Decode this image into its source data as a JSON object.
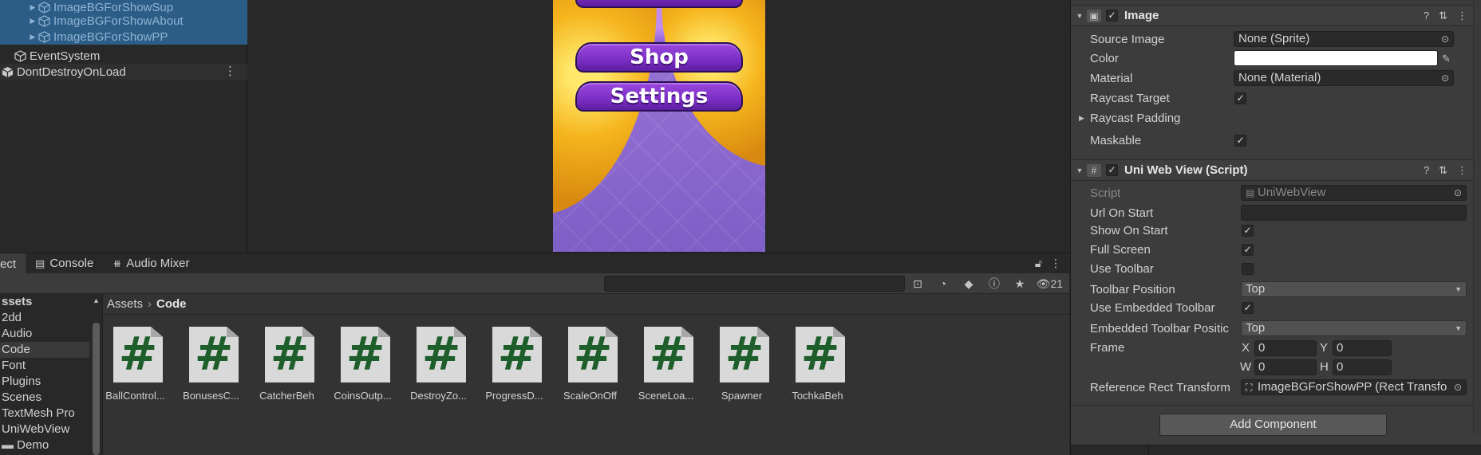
{
  "hierarchy": {
    "items": [
      {
        "label": "ImageBGForShowSup"
      },
      {
        "label": "ImageBGForShowAbout"
      },
      {
        "label": "ImageBGForShowPP"
      },
      {
        "label": "EventSystem"
      },
      {
        "label": "DontDestroyOnLoad"
      }
    ],
    "more_glyph": "⋮"
  },
  "game": {
    "buttons": [
      {
        "label": "Shop"
      },
      {
        "label": "Settings"
      }
    ]
  },
  "bottom_tabs": {
    "project": "ect",
    "console": "Console",
    "audio_mixer": "Audio Mixer"
  },
  "project": {
    "search_placeholder": "",
    "hidden_count": "21",
    "folders": [
      {
        "label": "ssets"
      },
      {
        "label": "2dd"
      },
      {
        "label": "Audio"
      },
      {
        "label": "Code"
      },
      {
        "label": "Font"
      },
      {
        "label": "Plugins"
      },
      {
        "label": "Scenes"
      },
      {
        "label": "TextMesh Pro"
      },
      {
        "label": "UniWebView"
      },
      {
        "label": "Demo"
      }
    ],
    "breadcrumb": {
      "root": "Assets",
      "current": "Code"
    },
    "assets": [
      {
        "name": "BallControl..."
      },
      {
        "name": "BonusesC..."
      },
      {
        "name": "CatcherBeh"
      },
      {
        "name": "CoinsOutp..."
      },
      {
        "name": "DestroyZo..."
      },
      {
        "name": "ProgressD..."
      },
      {
        "name": "ScaleOnOff"
      },
      {
        "name": "SceneLoa..."
      },
      {
        "name": "Spawner"
      },
      {
        "name": "TochkaBeh"
      }
    ]
  },
  "inspector": {
    "image": {
      "title": "Image",
      "source_image_label": "Source Image",
      "source_image_value": "None (Sprite)",
      "color_label": "Color",
      "color_value": "#ffffff",
      "material_label": "Material",
      "material_value": "None (Material)",
      "raycast_target_label": "Raycast Target",
      "raycast_padding_label": "Raycast Padding",
      "maskable_label": "Maskable"
    },
    "uniwebview": {
      "title": "Uni Web View (Script)",
      "script_label": "Script",
      "script_value": "UniWebView",
      "url_label": "Url On Start",
      "url_value": "",
      "show_on_start_label": "Show On Start",
      "full_screen_label": "Full Screen",
      "use_toolbar_label": "Use Toolbar",
      "toolbar_position_label": "Toolbar Position",
      "toolbar_position_value": "Top",
      "use_embedded_label": "Use Embedded Toolbar",
      "embedded_position_label": "Embedded Toolbar Positic",
      "embedded_position_value": "Top",
      "frame_label": "Frame",
      "frame": {
        "x_label": "X",
        "x": "0",
        "y_label": "Y",
        "y": "0",
        "w_label": "W",
        "w": "0",
        "h_label": "H",
        "h": "0"
      },
      "ref_rect_label": "Reference Rect Transform",
      "ref_rect_value": "ImageBGForShowPP (Rect Transfo"
    },
    "add_component": "Add Component"
  },
  "colors": {
    "selection": "#2c5d87",
    "panel": "#282828",
    "inspector": "#3c3c3c",
    "script_green": "#1d5e2b"
  }
}
